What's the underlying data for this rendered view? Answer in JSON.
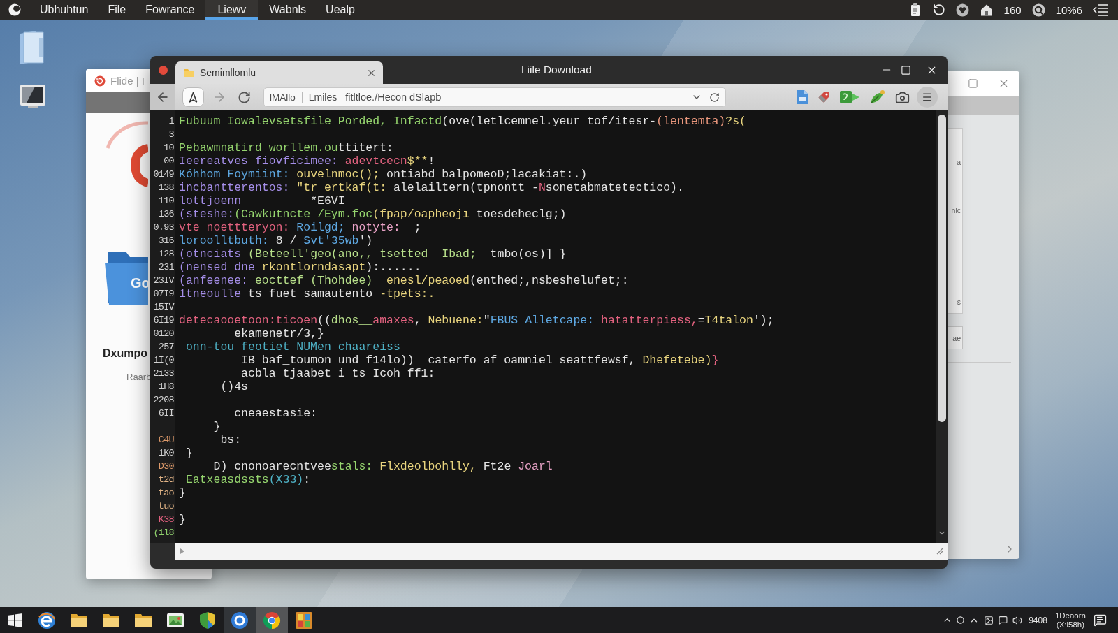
{
  "menu_bar": {
    "items": [
      {
        "label": "Ubhuhtun",
        "selected": false
      },
      {
        "label": "File",
        "selected": false
      },
      {
        "label": "Fowrance",
        "selected": false
      },
      {
        "label": "Liewv",
        "selected": true
      },
      {
        "label": "Wabnls",
        "selected": false
      },
      {
        "label": "Uealp",
        "selected": false
      }
    ],
    "status_texts": [
      "160",
      "10%6"
    ]
  },
  "left_window": {
    "title": "Flide | I",
    "folder_label": "Go",
    "heading": "Dxumpo",
    "caption": "Raarb"
  },
  "right_window": {
    "fragments": [
      "a",
      "nlc",
      "s"
    ],
    "button": "ae"
  },
  "browser": {
    "tab": {
      "label": "Semimllomlu"
    },
    "title": "Liile Download",
    "address": [
      "lMAllo",
      "Lmiles",
      "fitltloe./Hecon dSlapb"
    ],
    "code_lines": [
      {
        "number": {
          "text": "1",
          "color": "#d4d4d4"
        },
        "tokens": [
          {
            "text": "Fubuum Iowalevsetsfile Porded, Infactd",
            "color": "#95d46e"
          },
          {
            "text": "(ove(letlcemnel.yeur tof/itesr-",
            "color": "#e4e4e4"
          },
          {
            "text": "(lentemta)",
            "color": "#e8967c"
          },
          {
            "text": "?s(",
            "color": "#e8d47e"
          }
        ]
      },
      {
        "number": {
          "text": "3",
          "color": "#d4d4d4"
        }
      },
      {
        "number": {
          "text": "10",
          "color": "#d4d4d4"
        },
        "tokens": [
          {
            "text": "Pebawmnatird worllem.ou",
            "color": "#95d46e"
          },
          {
            "text": "ttitert:",
            "color": "#e4e4e4"
          }
        ]
      },
      {
        "number": {
          "text": "00",
          "color": "#d4d4d4"
        },
        "tokens": [
          {
            "text": "Ieereatves fiovficimee:",
            "color": "#a58ee8"
          },
          {
            "text": " adevtcecn",
            "color": "#e2627f"
          },
          {
            "text": "$**",
            "color": "#e8d47e"
          },
          {
            "text": "!",
            "color": "#e4e4e4"
          }
        ]
      },
      {
        "number": {
          "text": "0149",
          "color": "#d4d4d4"
        },
        "tokens": [
          {
            "text": "Kóhhom Foymiint:",
            "color": "#5ea8e2"
          },
          {
            "text": " ouvelnmoc();",
            "color": "#e8d47e"
          },
          {
            "text": " ontiabd balpomeoD;lacakiat:.)",
            "color": "#e4e4e4"
          }
        ]
      },
      {
        "number": {
          "text": "138",
          "color": "#d4d4d4"
        },
        "tokens": [
          {
            "text": "incbantterentos:",
            "color": "#a58ee8"
          },
          {
            "text": " \"tr ertkaf(t:",
            "color": "#e8d47e"
          },
          {
            "text": " alelailtern(tpnontt -",
            "color": "#e4e4e4"
          },
          {
            "text": "N",
            "color": "#e2627f"
          },
          {
            "text": "sonetabmatetectico).",
            "color": "#e4e4e4"
          }
        ]
      },
      {
        "number": {
          "text": "110",
          "color": "#d4d4d4"
        },
        "tokens": [
          {
            "text": "lottjoenn",
            "color": "#a58ee8"
          },
          {
            "text": "          *E6VI",
            "color": "#e4e4e4"
          }
        ]
      },
      {
        "number": {
          "text": "136",
          "color": "#d4d4d4"
        },
        "tokens": [
          {
            "text": "(steshe:",
            "color": "#a58ee8"
          },
          {
            "text": "(Cawkutncte /Eym.foc",
            "color": "#95d46e"
          },
          {
            "text": "(fpap/oapheojī",
            "color": "#e8d47e"
          },
          {
            "text": " toesdeheclg;)",
            "color": "#e4e4e4"
          }
        ]
      },
      {
        "number": {
          "text": "0.93",
          "color": "#d4d4d4"
        },
        "tokens": [
          {
            "text": "vte noettteryon:",
            "color": "#e2627f"
          },
          {
            "text": " Roilgd;",
            "color": "#5ea8e2"
          },
          {
            "text": " notyte:",
            "color": "#e8a2c6"
          },
          {
            "text": "  ;",
            "color": "#e4e4e4"
          }
        ]
      },
      {
        "number": {
          "text": "316",
          "color": "#d4d4d4"
        },
        "tokens": [
          {
            "text": "loroolltbuth:",
            "color": "#5ea8e2"
          },
          {
            "text": " 8 / ",
            "color": "#e4e4e4"
          },
          {
            "text": "Svt'35wb",
            "color": "#5ea8e2"
          },
          {
            "text": "')",
            "color": "#e4e4e4"
          }
        ]
      },
      {
        "number": {
          "text": "128",
          "color": "#d4d4d4"
        },
        "tokens": [
          {
            "text": "(otnciats",
            "color": "#a58ee8"
          },
          {
            "text": " (Beteell'geo(ano,, tsetted  Ibad;",
            "color": "#b7df8a"
          },
          {
            "text": "  tmbo(os)] }",
            "color": "#e4e4e4"
          }
        ]
      },
      {
        "number": {
          "text": "231",
          "color": "#d4d4d4"
        },
        "tokens": [
          {
            "text": "(nensed dne",
            "color": "#a58ee8"
          },
          {
            "text": " rkontlorndasapt",
            "color": "#e8d47e"
          },
          {
            "text": "):......",
            "color": "#e4e4e4"
          }
        ]
      },
      {
        "number": {
          "text": "23IV",
          "color": "#d4d4d4"
        },
        "tokens": [
          {
            "text": "(anfeenee:",
            "color": "#a58ee8"
          },
          {
            "text": " eocttef (Thohdee)",
            "color": "#b7df8a"
          },
          {
            "text": "  enesl/peaoed",
            "color": "#e8d47e"
          },
          {
            "text": "(enthed;,nsbeshelufet;:",
            "color": "#e4e4e4"
          }
        ]
      },
      {
        "number": {
          "text": "07I9",
          "color": "#d4d4d4"
        },
        "tokens": [
          {
            "text": "1tneoulle",
            "color": "#a58ee8"
          },
          {
            "text": " ts fuet samautento ",
            "color": "#e4e4e4"
          },
          {
            "text": "-tpets:.",
            "color": "#e8d47e"
          }
        ]
      },
      {
        "number": {
          "text": "15IV",
          "color": "#d4d4d4"
        }
      },
      {
        "number": {
          "text": "6I19",
          "color": "#d4d4d4"
        },
        "tokens": [
          {
            "text": "detecaooetoon:ticoen",
            "color": "#e2627f"
          },
          {
            "text": "((",
            "color": "#e4e4e4"
          },
          {
            "text": "dhos__",
            "color": "#b7df8a"
          },
          {
            "text": "amaxes",
            "color": "#e2627f"
          },
          {
            "text": ", ",
            "color": "#e4e4e4"
          },
          {
            "text": "Nebuene:",
            "color": "#e8d47e"
          },
          {
            "text": "\"",
            "color": "#e4e4e4"
          },
          {
            "text": "FBUS Alletcape:",
            "color": "#5ea8e2"
          },
          {
            "text": " hatatterpiess,",
            "color": "#e2627f"
          },
          {
            "text": "=",
            "color": "#e4e4e4"
          },
          {
            "text": "T4talon",
            "color": "#e8d47e"
          },
          {
            "text": "');",
            "color": "#e4e4e4"
          }
        ]
      },
      {
        "number": {
          "text": "0120",
          "color": "#d4d4d4"
        },
        "tokens": [
          {
            "text": "        ekamenetr/3,}",
            "color": "#e4e4e4"
          }
        ]
      },
      {
        "number": {
          "text": "257",
          "color": "#d4d4d4"
        },
        "tokens": [
          {
            "text": " onn-tou feotiet NUMen chaareiss",
            "color": "#4fb2c6"
          }
        ]
      },
      {
        "number": {
          "text": "1I(0",
          "color": "#d4d4d4"
        },
        "tokens": [
          {
            "text": "         IB baf_toumon und f14lo))  caterfo af oamniel seattfewsf, ",
            "color": "#e4e4e4"
          },
          {
            "text": "Dhefetebe)",
            "color": "#e8d47e"
          },
          {
            "text": "}",
            "color": "#e2627f"
          }
        ]
      },
      {
        "number": {
          "text": "2i33",
          "color": "#d4d4d4"
        },
        "tokens": [
          {
            "text": "         acbla tjaabet i ts Icoh ff1:",
            "color": "#e4e4e4"
          }
        ]
      },
      {
        "number": {
          "text": "1H8",
          "color": "#d4d4d4"
        },
        "tokens": [
          {
            "text": "      ()4s",
            "color": "#e4e4e4"
          }
        ]
      },
      {
        "number": {
          "text": "2208",
          "color": "#d4d4d4"
        }
      },
      {
        "number": {
          "text": "6II",
          "color": "#d4d4d4"
        },
        "tokens": [
          {
            "text": "        cneaestasie:",
            "color": "#e4e4e4"
          }
        ]
      },
      {
        "tokens": [
          {
            "text": "     }",
            "color": "#e4e4e4"
          }
        ]
      },
      {
        "number": {
          "text": "C4U",
          "color": "#de9a6a"
        },
        "tokens": [
          {
            "text": "      bs:",
            "color": "#e4e4e4"
          }
        ]
      },
      {
        "number": {
          "text": "1K0",
          "color": "#d4d4d4"
        },
        "tokens": [
          {
            "text": " }",
            "color": "#e4e4e4"
          }
        ]
      },
      {
        "number": {
          "text": "D30",
          "color": "#de9a6a"
        },
        "tokens": [
          {
            "text": "     D) cnonoarecntvee",
            "color": "#e4e4e4"
          },
          {
            "text": "stals:",
            "color": "#95d46e"
          },
          {
            "text": " Flxdeolbohlly,",
            "color": "#e8d47e"
          },
          {
            "text": " Ft2e",
            "color": "#e4e4e4"
          },
          {
            "text": " Joarl",
            "color": "#e8a2c6"
          }
        ]
      },
      {
        "number": {
          "text": "t2d",
          "color": "#e2b486"
        },
        "tokens": [
          {
            "text": " Eatxeasdssts",
            "color": "#95d46e"
          },
          {
            "text": "(X33)",
            "color": "#4fb2c6"
          },
          {
            "text": ":",
            "color": "#e4e4e4"
          }
        ]
      },
      {
        "number": {
          "text": "tao",
          "color": "#e2b486"
        },
        "tokens": [
          {
            "text": "}",
            "color": "#e4e4e4"
          }
        ]
      },
      {
        "number": {
          "text": "tuo",
          "color": "#e2b486"
        }
      },
      {
        "number": {
          "text": "K38",
          "color": "#e0607e"
        },
        "tokens": [
          {
            "text": "}",
            "color": "#e4e4e4"
          }
        ]
      },
      {
        "number": {
          "text": "(il8",
          "color": "#8fd06c"
        }
      }
    ]
  },
  "taskbar": {
    "apps": [
      {
        "active": false,
        "selected": false
      },
      {
        "active": false,
        "selected": false
      },
      {
        "active": false,
        "selected": false
      },
      {
        "active": false,
        "selected": false
      },
      {
        "active": false,
        "selected": false
      },
      {
        "active": false,
        "selected": false
      },
      {
        "active": true,
        "selected": false
      },
      {
        "active": true,
        "selected": true
      },
      {
        "active": false,
        "selected": false
      }
    ],
    "tray_text": "9408",
    "clock": [
      "1Deaorn",
      "(X:i58h)"
    ]
  }
}
